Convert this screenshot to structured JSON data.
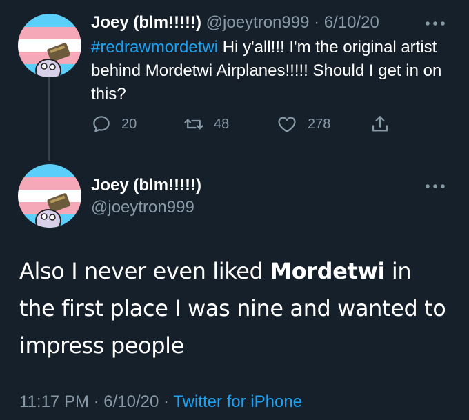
{
  "colors": {
    "background": "#15202b",
    "text_primary": "#ffffff",
    "text_secondary": "#8899a6",
    "accent": "#1da1f2",
    "thread_line": "#38444d",
    "trans_blue": "#5bcefa",
    "trans_pink": "#f5a9b8",
    "trans_white": "#ffffff"
  },
  "tweet1": {
    "name": "Joey (blm!!!!!)",
    "handle": "@joeytron999",
    "separator": "·",
    "date": "6/10/20",
    "hashtag": "#redrawmordetwi",
    "text": " Hi y'all!!! I'm the original artist behind Mordetwi Airplanes!!!!! Should I get in on this?",
    "replies": "20",
    "retweets": "48",
    "likes": "278",
    "icons": {
      "more": "more-horizontal-icon",
      "reply": "reply-icon",
      "retweet": "retweet-icon",
      "like": "heart-icon",
      "share": "share-icon"
    }
  },
  "tweet2": {
    "name": "Joey (blm!!!!!)",
    "handle": "@joeytron999",
    "text_before": "Also I never even liked ",
    "text_bold": "Mordetwi",
    "text_after": " in the first place I was nine and wanted to impress people",
    "time": "11:17 PM",
    "separator": "·",
    "date": "6/10/20",
    "source": "Twitter for iPhone"
  }
}
